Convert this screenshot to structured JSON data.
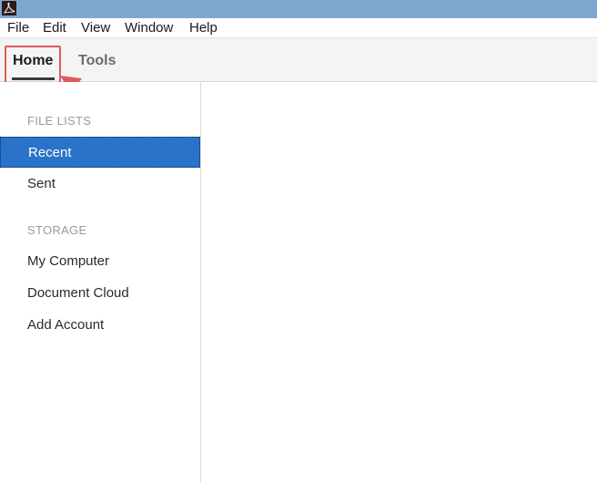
{
  "app": {
    "icon": "acrobat-icon"
  },
  "menubar": {
    "items": [
      "File",
      "Edit",
      "View",
      "Window",
      "Help"
    ]
  },
  "tabs": {
    "home": "Home",
    "tools": "Tools",
    "active": "Home"
  },
  "sidebar": {
    "file_lists_header": "FILE LISTS",
    "file_lists": [
      "Recent",
      "Sent"
    ],
    "selected": "Recent",
    "storage_header": "STORAGE",
    "storage": [
      "My Computer",
      "Document Cloud",
      "Add Account"
    ]
  },
  "colors": {
    "titlebar": "#7fa8d0",
    "selected_item": "#2a73c8",
    "annotation": "#e05a5a"
  }
}
